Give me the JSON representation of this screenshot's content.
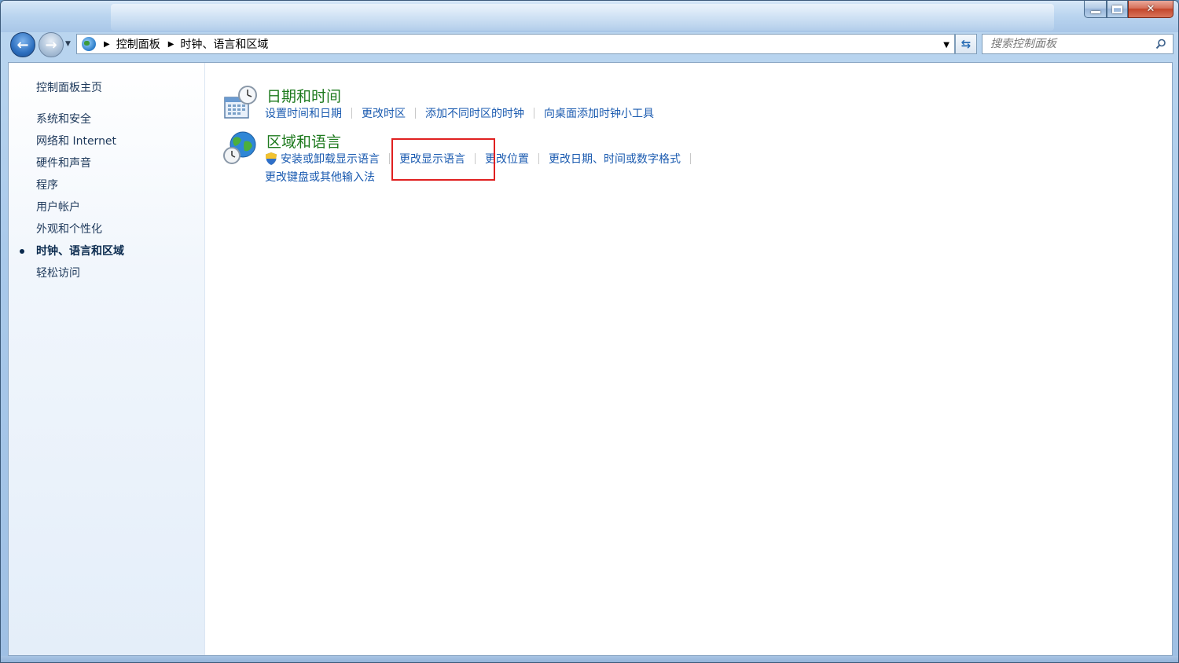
{
  "search": {
    "placeholder": "搜索控制面板"
  },
  "breadcrumb": {
    "items": [
      "控制面板",
      "时钟、语言和区域"
    ]
  },
  "sidebar": {
    "home": "控制面板主页",
    "items": [
      {
        "label": "系统和安全"
      },
      {
        "label": "网络和 Internet"
      },
      {
        "label": "硬件和声音"
      },
      {
        "label": "程序"
      },
      {
        "label": "用户帐户"
      },
      {
        "label": "外观和个性化"
      },
      {
        "label": "时钟、语言和区域",
        "active": true
      },
      {
        "label": "轻松访问"
      }
    ]
  },
  "main": {
    "categories": [
      {
        "title": "日期和时间",
        "links": [
          "设置时间和日期",
          "更改时区",
          "添加不同时区的时钟",
          "向桌面添加时钟小工具"
        ]
      },
      {
        "title": "区域和语言",
        "links": [
          "安装或卸载显示语言",
          "更改显示语言",
          "更改位置",
          "更改日期、时间或数字格式"
        ],
        "extra_link": "更改键盘或其他输入法"
      }
    ]
  },
  "colors": {
    "link": "#1b5bb0",
    "category_title": "#1e7a1e",
    "highlight": "#e02020"
  },
  "icons": {
    "back": "back-arrow-icon",
    "forward": "forward-arrow-icon",
    "refresh": "refresh-icon",
    "search": "search-icon",
    "datetime": "calendar-clock-icon",
    "region": "globe-clock-icon",
    "shield": "uac-shield-icon"
  }
}
